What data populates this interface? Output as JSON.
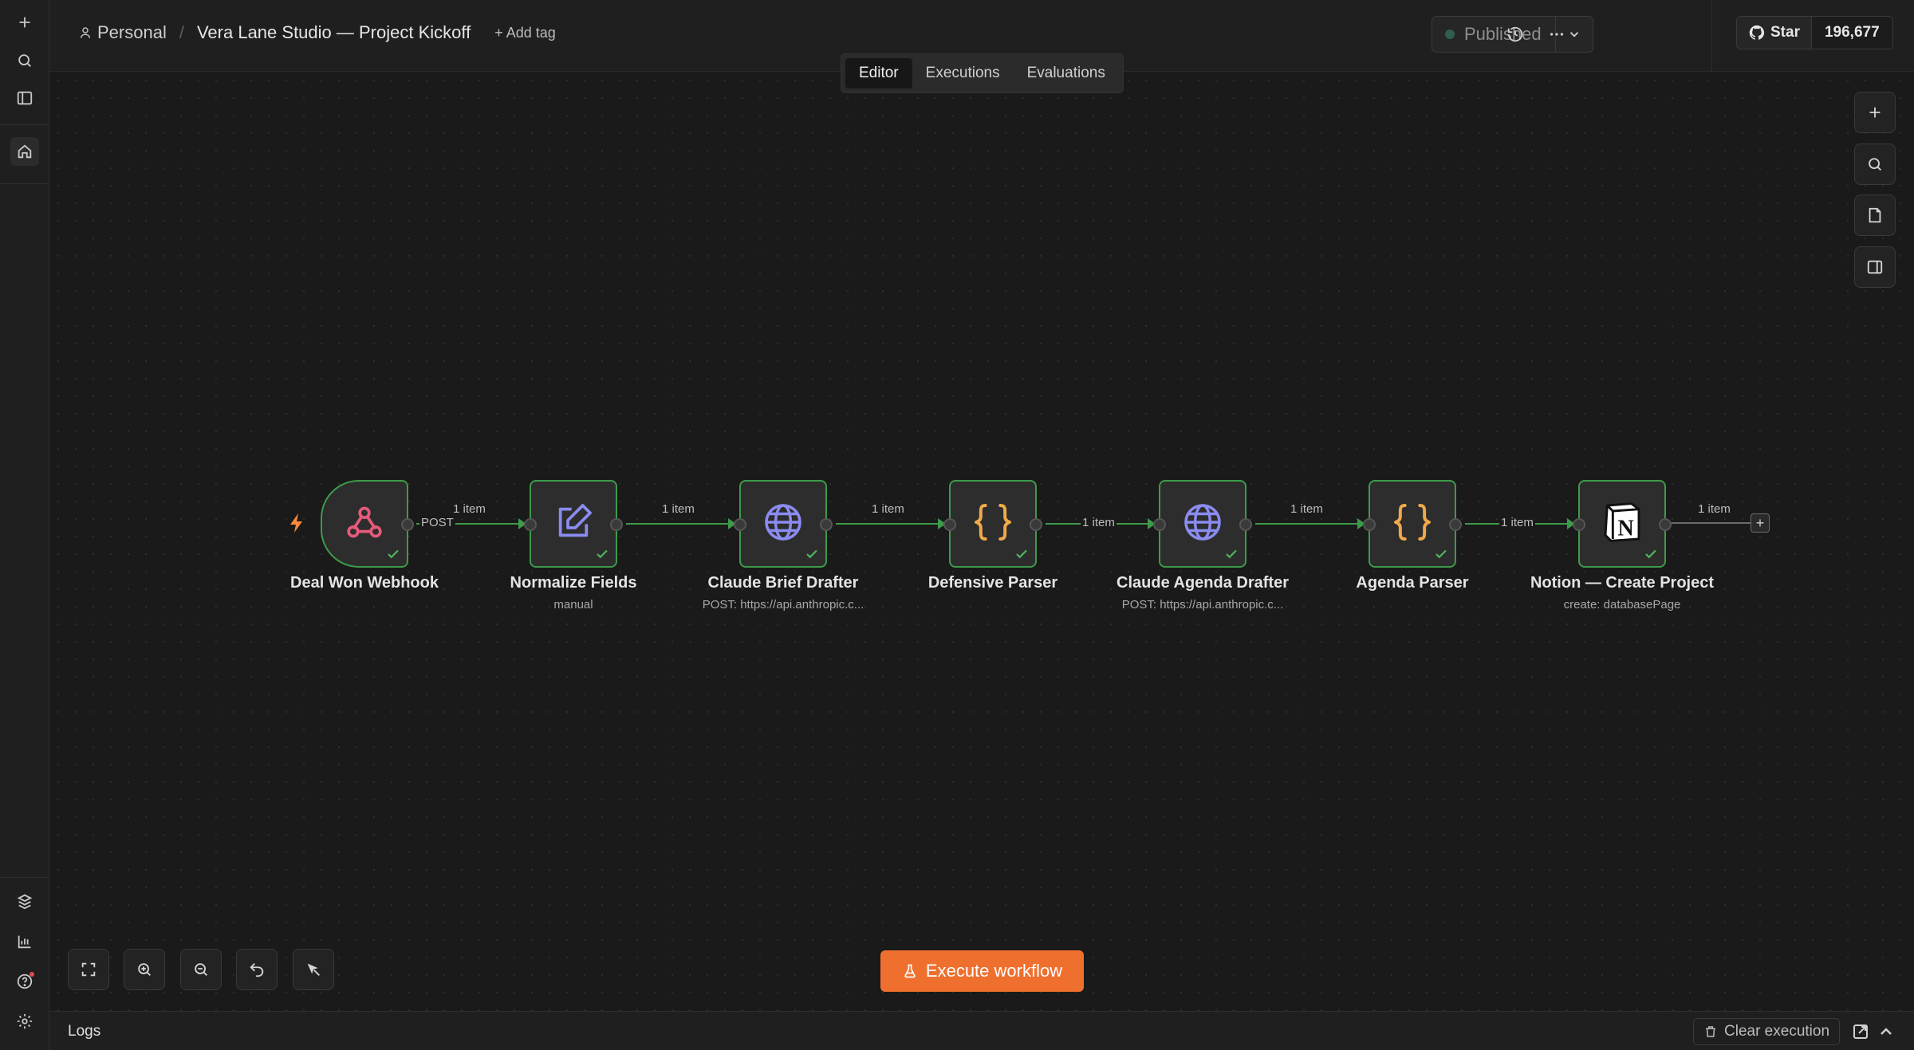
{
  "breadcrumb": {
    "owner": "Personal",
    "workflow_name": "Vera Lane Studio — Project Kickoff",
    "add_tag": "+ Add tag"
  },
  "header": {
    "status": "Published"
  },
  "github": {
    "star_label": "Star",
    "star_count": "196,677"
  },
  "tabs": [
    {
      "label": "Editor",
      "active": true
    },
    {
      "label": "Executions",
      "active": false
    },
    {
      "label": "Evaluations",
      "active": false
    }
  ],
  "nodes": [
    {
      "name": "Deal Won Webhook",
      "subtitle": "",
      "icon": "webhook-icon",
      "status": "success"
    },
    {
      "name": "Normalize Fields",
      "subtitle": "manual",
      "icon": "edit-icon",
      "status": "success"
    },
    {
      "name": "Claude Brief Drafter",
      "subtitle": "POST: https://api.anthropic.c...",
      "icon": "globe-icon",
      "status": "success"
    },
    {
      "name": "Defensive Parser",
      "subtitle": "",
      "icon": "code-icon",
      "status": "success"
    },
    {
      "name": "Claude Agenda Drafter",
      "subtitle": "POST: https://api.anthropic.c...",
      "icon": "globe-icon",
      "status": "success"
    },
    {
      "name": "Agenda Parser",
      "subtitle": "",
      "icon": "code-icon",
      "status": "success"
    },
    {
      "name": "Notion — Create Project",
      "subtitle": "create: databasePage",
      "icon": "notion-icon",
      "status": "success"
    }
  ],
  "edges": [
    {
      "label": "1 item",
      "output_label": "POST"
    },
    {
      "label": "1 item"
    },
    {
      "label": "1 item"
    },
    {
      "label": "1 item"
    },
    {
      "label": "1 item"
    },
    {
      "label": "1 item"
    },
    {
      "label": "1 item"
    }
  ],
  "execute_button": "Execute workflow",
  "logs": {
    "title": "Logs",
    "clear_label": "Clear execution"
  },
  "colors": {
    "accent": "#ef6f2e",
    "success": "#3e9a4a",
    "webhook": "#e65a7a",
    "http": "#8a8cf0",
    "code": "#f0a94a"
  }
}
